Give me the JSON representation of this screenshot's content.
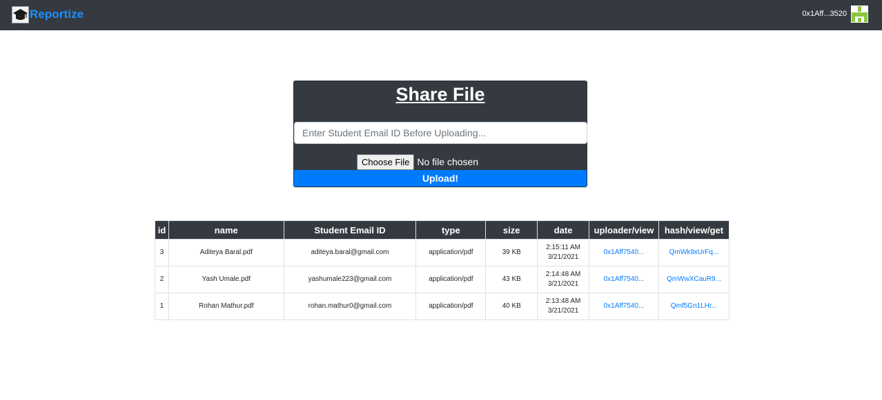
{
  "navbar": {
    "brand": "Reportize",
    "account": "0x1Aff...3520"
  },
  "share": {
    "title": "Share File",
    "email_placeholder": "Enter Student Email ID Before Uploading...",
    "choose_file_label": "Choose File",
    "no_file_text": "No file chosen",
    "upload_label": "Upload!"
  },
  "table": {
    "headers": [
      "id",
      "name",
      "Student Email ID",
      "type",
      "size",
      "date",
      "uploader/view",
      "hash/view/get"
    ],
    "rows": [
      {
        "id": "3",
        "name": "Aditeya Baral.pdf",
        "email": "aditeya.baral@gmail.com",
        "type": "application/pdf",
        "size": "39 KB",
        "time": "2:15:11 AM",
        "date": "3/21/2021",
        "uploader": "0x1Aff7540...",
        "hash": "QmWk9xUrFq..."
      },
      {
        "id": "2",
        "name": "Yash Umale.pdf",
        "email": "yashumale223@gmail.com",
        "type": "application/pdf",
        "size": "43 KB",
        "time": "2:14:48 AM",
        "date": "3/21/2021",
        "uploader": "0x1Aff7540...",
        "hash": "QmWwXCauR9..."
      },
      {
        "id": "1",
        "name": "Rohan Mathur.pdf",
        "email": "rohan.mathur0@gmail.com",
        "type": "application/pdf",
        "size": "40 KB",
        "time": "2:13:48 AM",
        "date": "3/21/2021",
        "uploader": "0x1Aff7540...",
        "hash": "Qmf5Gn1LHr..."
      }
    ]
  },
  "colors": {
    "navbar_bg": "#343a40",
    "brand": "#1e90ff",
    "primary": "#007bff",
    "identicon": "#8cc63f"
  },
  "icons": {
    "logo": "graduation-cap-icon",
    "avatar": "identicon-avatar"
  }
}
